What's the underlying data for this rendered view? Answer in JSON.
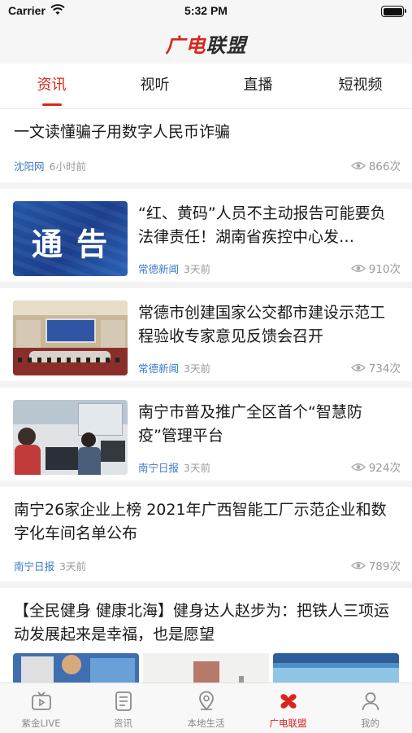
{
  "status_bar": {
    "carrier": "Carrier",
    "time": "5:32 PM"
  },
  "header": {
    "logo_part1": "广电",
    "logo_part2": "联盟"
  },
  "tabs": [
    {
      "label": "资讯",
      "active": true
    },
    {
      "label": "视听",
      "active": false
    },
    {
      "label": "直播",
      "active": false
    },
    {
      "label": "短视频",
      "active": false
    }
  ],
  "news": [
    {
      "title": "一文读懂骗子用数字人民币诈骗",
      "source": "沈阳网",
      "time": "6小时前",
      "views": "866次",
      "thumb": ""
    },
    {
      "title": "“红、黄码”人员不主动报告可能要负法律责任！湖南省疾控中心发…",
      "source": "常德新闻",
      "time": "3天前",
      "views": "910次",
      "thumb": "notice-image",
      "thumb_text": "通 告"
    },
    {
      "title": "常德市创建国家公交都市建设示范工程验收专家意见反馈会召开",
      "source": "常德新闻",
      "time": "3天前",
      "views": "734次",
      "thumb": "meeting-photo"
    },
    {
      "title": "南宁市普及推广全区首个“智慧防疫”管理平台",
      "source": "南宁日报",
      "time": "3天前",
      "views": "924次",
      "thumb": "office-photo"
    },
    {
      "title": "南宁26家企业上榜 2021年广西智能工厂示范企业和数字化车间名单公布",
      "source": "南宁日报",
      "time": "3天前",
      "views": "789次",
      "thumb": ""
    },
    {
      "title": "【全民健身 健康北海】健身达人赵步为：把铁人三项运动发展起来是幸福，也是愿望",
      "source": "",
      "time": "",
      "views": "",
      "thumb": "sports-photos"
    }
  ],
  "bottom_nav": [
    {
      "label": "紫金LIVE",
      "icon": "tv-icon",
      "active": false
    },
    {
      "label": "资讯",
      "icon": "news-icon",
      "active": false
    },
    {
      "label": "本地生活",
      "icon": "location-icon",
      "active": false
    },
    {
      "label": "广电联盟",
      "icon": "alliance-icon",
      "active": true
    },
    {
      "label": "我的",
      "icon": "person-icon",
      "active": false
    }
  ],
  "colors": {
    "accent": "#d9261c",
    "source_link": "#3d7ac7",
    "muted": "#9a9a9a"
  }
}
